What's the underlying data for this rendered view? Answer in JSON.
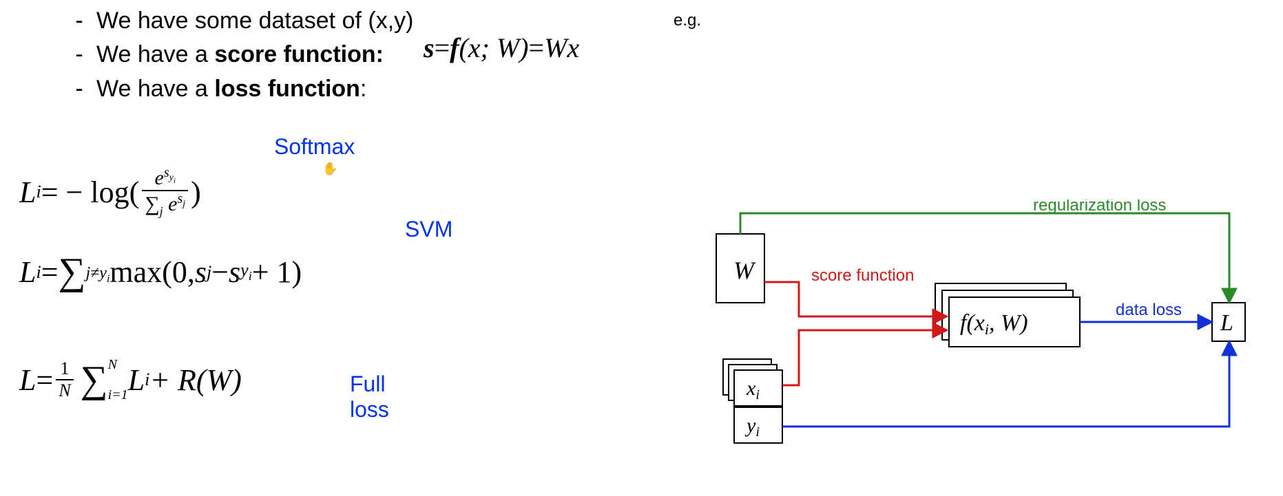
{
  "bullets": {
    "b1_pre": "We have some dataset of (x,y)",
    "b2_pre": "We have a ",
    "b2_bold": "score function:",
    "b3_pre": "We have a ",
    "b3_bold": "loss function",
    "b3_post": ":"
  },
  "score": {
    "eg": "e.g.",
    "s": "s",
    "eq1": " = ",
    "f": "f",
    "args": "(x; W)",
    "eq2": " = ",
    "rhs": "Wx"
  },
  "labels": {
    "softmax": "Softmax",
    "svm": "SVM",
    "full": "Full loss"
  },
  "eq_softmax": {
    "Li": "L",
    "i": "i",
    "eq": " = − log(",
    "num_e": "e",
    "num_exp": "s",
    "num_exp_sub": "y",
    "num_exp_sub_i": "i",
    "den_sum": "∑",
    "den_j": "j",
    "den_e": " e",
    "den_exp": "s",
    "den_exp_j": "j",
    "close": ")"
  },
  "eq_svm": {
    "Li": "L",
    "i": "i",
    "eq": " = ",
    "sum": "∑",
    "sub": "j≠y",
    "sub_i": "i",
    "body_a": " max(0, ",
    "sj": "s",
    "j": "j",
    "mid": " − ",
    "sy": "s",
    "y": "y",
    "yi": "i",
    "tail": " + 1)"
  },
  "eq_full": {
    "L": "L",
    "eq": " = ",
    "one": "1",
    "N": "N",
    "sum": "∑",
    "sup": "N",
    "sub": "i=1",
    "Li": " L",
    "i": "i",
    "plus": " + R(W)"
  },
  "diagram": {
    "W": "W",
    "xi": "x",
    "xi_sub": "i",
    "yi": "y",
    "yi_sub": "i",
    "f": "f(x",
    "f_sub": "i",
    "f_tail": ", W)",
    "L": "L",
    "reg": "regularization loss",
    "score": "score function",
    "data": "data loss"
  },
  "colors": {
    "blue": "#0033ee",
    "green": "#2a8a2a",
    "red": "#d01818",
    "dblue": "#1030d8"
  }
}
